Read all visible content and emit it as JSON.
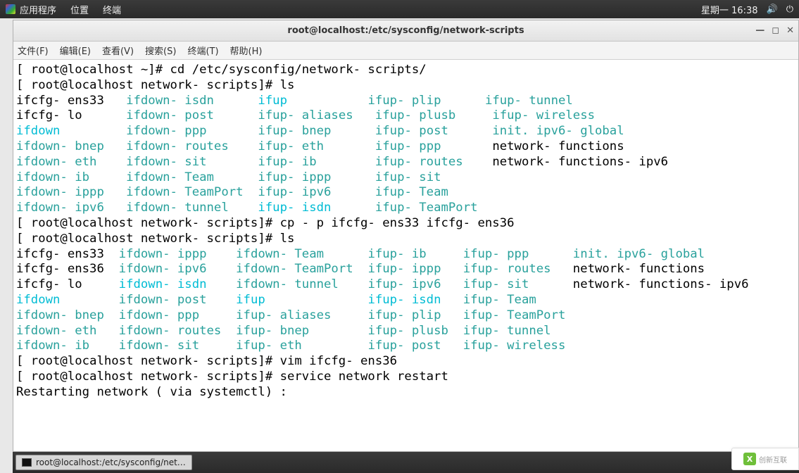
{
  "top_panel": {
    "apps": "应用程序",
    "locations": "位置",
    "terminal": "终端",
    "clock": "星期一 16:38"
  },
  "window": {
    "title": "root@localhost:/etc/sysconfig/network-scripts"
  },
  "menubar": {
    "file": "文件(F)",
    "edit": "编辑(E)",
    "view": "查看(V)",
    "search": "搜索(S)",
    "terminal": "终端(T)",
    "help": "帮助(H)"
  },
  "prompt": {
    "home": "[ root@localhost ~]# ",
    "ns": "[ root@localhost network- scripts]# "
  },
  "cmd": {
    "cd": "cd /etc/sysconfig/network- scripts/",
    "ls": "ls",
    "cp": "cp - p ifcfg- ens33 ifcfg- ens36",
    "vim": "vim ifcfg- ens36",
    "svc": "service network restart",
    "restarting": "Restarting network ( via systemctl) :"
  },
  "ls1": {
    "r0": {
      "c0": "ifcfg- ens33",
      "c1": "ifdown- isdn",
      "c2": "ifup",
      "c3": "ifup- plip",
      "c4": "ifup- tunnel"
    },
    "r1": {
      "c0": "ifcfg- lo",
      "c1": "ifdown- post",
      "c2": "ifup- aliases",
      "c3": "ifup- plusb",
      "c4": "ifup- wireless"
    },
    "r2": {
      "c0": "ifdown",
      "c1": "ifdown- ppp",
      "c2": "ifup- bnep",
      "c3": "ifup- post",
      "c4": "init. ipv6- global"
    },
    "r3": {
      "c0": "ifdown- bnep",
      "c1": "ifdown- routes",
      "c2": "ifup- eth",
      "c3": "ifup- ppp",
      "c4": "network- functions"
    },
    "r4": {
      "c0": "ifdown- eth",
      "c1": "ifdown- sit",
      "c2": "ifup- ib",
      "c3": "ifup- routes",
      "c4": "network- functions- ipv6"
    },
    "r5": {
      "c0": "ifdown- ib",
      "c1": "ifdown- Team",
      "c2": "ifup- ippp",
      "c3": "ifup- sit"
    },
    "r6": {
      "c0": "ifdown- ippp",
      "c1": "ifdown- TeamPort",
      "c2": "ifup- ipv6",
      "c3": "ifup- Team"
    },
    "r7": {
      "c0": "ifdown- ipv6",
      "c1": "ifdown- tunnel",
      "c2": "ifup- isdn",
      "c3": "ifup- TeamPort"
    }
  },
  "ls2": {
    "r0": {
      "c0": "ifcfg- ens33",
      "c1": "ifdown- ippp",
      "c2": "ifdown- Team",
      "c3": "ifup- ib",
      "c4": "ifup- ppp",
      "c5": "init. ipv6- global"
    },
    "r1": {
      "c0": "ifcfg- ens36",
      "c1": "ifdown- ipv6",
      "c2": "ifdown- TeamPort",
      "c3": "ifup- ippp",
      "c4": "ifup- routes",
      "c5": "network- functions"
    },
    "r2": {
      "c0": "ifcfg- lo",
      "c1": "ifdown- isdn",
      "c2": "ifdown- tunnel",
      "c3": "ifup- ipv6",
      "c4": "ifup- sit",
      "c5": "network- functions- ipv6"
    },
    "r3": {
      "c0": "ifdown",
      "c1": "ifdown- post",
      "c2": "ifup",
      "c3": "ifup- isdn",
      "c4": "ifup- Team"
    },
    "r4": {
      "c0": "ifdown- bnep",
      "c1": "ifdown- ppp",
      "c2": "ifup- aliases",
      "c3": "ifup- plip",
      "c4": "ifup- TeamPort"
    },
    "r5": {
      "c0": "ifdown- eth",
      "c1": "ifdown- routes",
      "c2": "ifup- bnep",
      "c3": "ifup- plusb",
      "c4": "ifup- tunnel"
    },
    "r6": {
      "c0": "ifdown- ib",
      "c1": "ifdown- sit",
      "c2": "ifup- eth",
      "c3": "ifup- post",
      "c4": "ifup- wireless"
    }
  },
  "taskbar": {
    "item": "root@localhost:/etc/sysconfig/net…"
  },
  "watermark": "创新互联"
}
